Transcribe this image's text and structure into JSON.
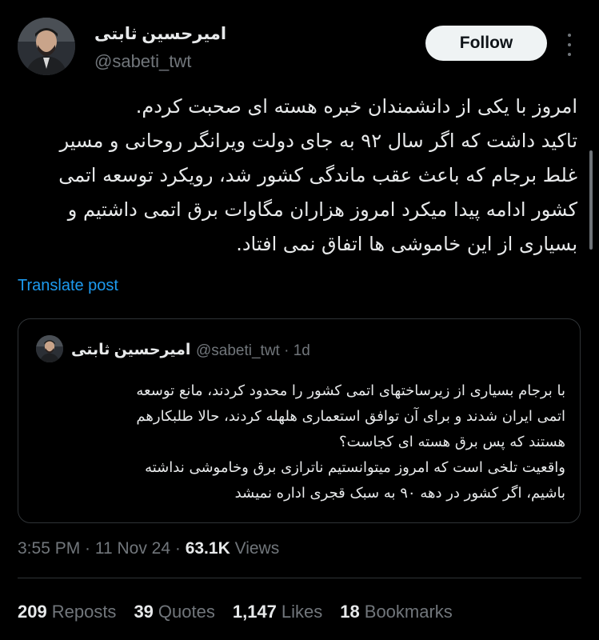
{
  "author": {
    "display_name": "امیرحسین ثابتی",
    "handle": "@sabeti_twt"
  },
  "follow_label": "Follow",
  "more_icon": "more-icon",
  "post_lines": [
    "امروز با یکی از دانشمندان خبره هسته ای صحبت کردم.",
    "تاکید داشت که اگر سال ۹۲ به جای دولت ویرانگر روحانی و مسیر",
    "غلط برجام که باعث عقب ماندگی کشور شد، رویکرد توسعه اتمی",
    "کشور ادامه پیدا میکرد امروز هزاران مگاوات برق اتمی داشتیم و",
    "بسیاری از این خاموشی ها اتفاق نمی افتاد."
  ],
  "translate_label": "Translate post",
  "quote": {
    "display_name": "امیرحسین ثابتی",
    "handle_time": "@sabeti_twt · 1d",
    "lines": [
      "با برجام بسیاری از زیرساختهای اتمی کشور را محدود کردند، مانع توسعه",
      "اتمی ایران شدند و برای آن توافق استعماری هلهله کردند، حالا طلبکارهم",
      "هستند که پس برق هسته ای کجاست؟",
      "واقعیت تلخی است که امروز میتوانستیم ناترازی برق وخاموشی نداشته",
      "باشیم، اگر کشور در دهه ۹۰ به سبک قجری اداره نمیشد"
    ]
  },
  "meta": {
    "time_date": "3:55 PM · 11 Nov 24 · ",
    "views_count": "63.1K",
    "views_label": " Views"
  },
  "stats": [
    {
      "count": "209",
      "label": "Reposts"
    },
    {
      "count": "39",
      "label": "Quotes"
    },
    {
      "count": "1,147",
      "label": "Likes"
    },
    {
      "count": "18",
      "label": "Bookmarks"
    }
  ]
}
